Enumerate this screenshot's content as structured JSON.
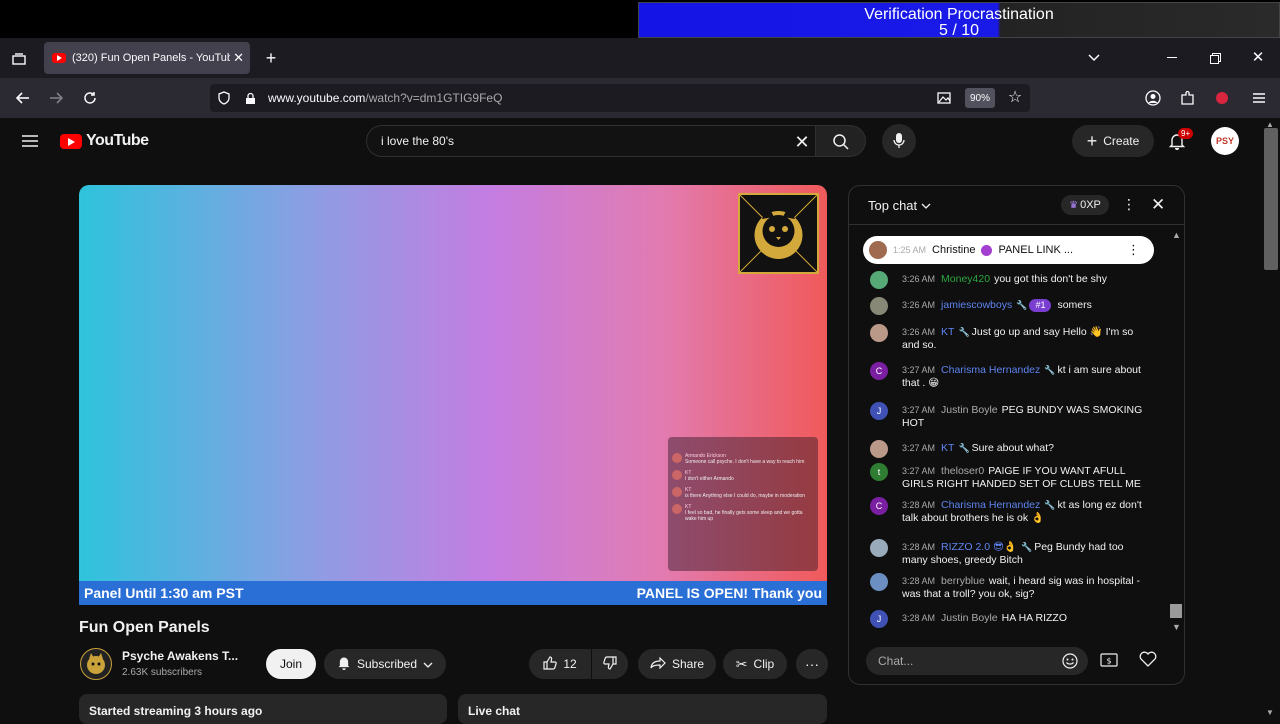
{
  "overlay": {
    "title": "Verification Procrastination",
    "progress_text": "5 / 10",
    "progress": 0.5
  },
  "browser": {
    "tab_title": "(320) Fun Open Panels - YouTub",
    "url_host": "www.youtube.com",
    "url_path": "/watch?v=dm1GTIG9FeQ",
    "zoom": "90%"
  },
  "youtube": {
    "logo_text": "YouTube",
    "search_value": "i love the 80's",
    "create_label": "Create",
    "notif_count": "9+",
    "avatar_text": "PSY"
  },
  "video": {
    "ticker_left": "Panel Until 1:30 am PST",
    "ticker_right": "PANEL IS OPEN! Thank you",
    "overlay_chat": [
      {
        "name": "Armando Erickson",
        "text": "Someone call psyche. I don't have a way to reach him"
      },
      {
        "name": "KT",
        "text": "I don't either Armando"
      },
      {
        "name": "KT",
        "text": "is there Anything else I could do, maybe in moderation"
      },
      {
        "name": "KT",
        "text": "I feel so bad, he finally gets some sleep and we gotta wake him up"
      }
    ]
  },
  "meta": {
    "title": "Fun Open Panels",
    "channel_name": "Psyche Awakens T...",
    "subscribers": "2.63K subscribers",
    "join_label": "Join",
    "subscribed_label": "Subscribed",
    "likes": "12",
    "share_label": "Share",
    "clip_label": "Clip",
    "started": "Started streaming 3 hours ago",
    "live_chat_label": "Live chat"
  },
  "chat": {
    "header": "Top chat",
    "xp": "0XP",
    "pinned": {
      "time": "1:25 AM",
      "author": "Christine",
      "text": "PANEL LINK ..."
    },
    "input_placeholder": "Chat...",
    "messages": [
      {
        "time": "3:26 AM",
        "author": "Money420",
        "text": "you got this don't be shy",
        "color": "green",
        "avatar": "#5a7",
        "initial": ""
      },
      {
        "time": "3:26 AM",
        "author": "jamiescowboys",
        "extra": "#1",
        "text": "somers",
        "color": "blue",
        "avatar": "#887",
        "initial": ""
      },
      {
        "time": "3:26 AM",
        "author": "KT",
        "text": "Just go up and say Hello 👋 I'm so and so.",
        "color": "blue",
        "avatar": "#b98",
        "initial": ""
      },
      {
        "time": "3:27 AM",
        "author": "Charisma Hernandez",
        "text": "kt i am sure about that . 😁",
        "color": "blue",
        "avatar": "#7b1fa2",
        "initial": "C"
      },
      {
        "time": "3:27 AM",
        "author": "Justin Boyle",
        "text": "PEG BUNDY WAS SMOKING HOT",
        "color": "gray",
        "avatar": "#3f51b5",
        "initial": "J"
      },
      {
        "time": "3:27 AM",
        "author": "KT",
        "text": "Sure about what?",
        "color": "blue",
        "avatar": "#b98",
        "initial": ""
      },
      {
        "time": "3:27 AM",
        "author": "theloser0",
        "text": "PAIGE IF YOU WANT AFULL GIRLS RIGHT HANDED SET OF CLUBS TELL ME",
        "color": "gray",
        "avatar": "#2e7d32",
        "initial": "t"
      },
      {
        "time": "3:28 AM",
        "author": "Charisma Hernandez",
        "text": "kt as long ez don't talk about brothers he is ok 👌",
        "color": "blue",
        "avatar": "#7b1fa2",
        "initial": "C"
      },
      {
        "time": "3:28 AM",
        "author": "RIZZO 2.0 😎👌",
        "text": "Peg Bundy had too many shoes, greedy Bitch",
        "color": "blue",
        "avatar": "#9ab",
        "initial": ""
      },
      {
        "time": "3:28 AM",
        "author": "berryblue",
        "text": "wait, i heard sig was in hospital - was that a troll? you ok, sig?",
        "color": "gray",
        "avatar": "#6a8fc0",
        "initial": ""
      },
      {
        "time": "3:28 AM",
        "author": "Justin Boyle",
        "text": "HA HA RIZZO",
        "color": "gray",
        "avatar": "#3f51b5",
        "initial": "J"
      }
    ]
  }
}
